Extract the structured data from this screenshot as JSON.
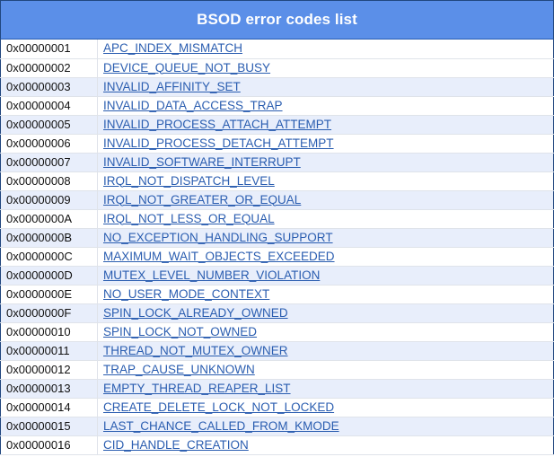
{
  "header": {
    "title": "BSOD error codes list",
    "background_color": "#5b8fe8",
    "text_color": "#ffffff"
  },
  "table": {
    "columns": [
      "code",
      "name"
    ],
    "link_color": "#2a5db0",
    "alt_row_color": "#e8eefb",
    "rows": [
      {
        "code": "0x00000001",
        "name": "APC_INDEX_MISMATCH",
        "shaded": false
      },
      {
        "code": "0x00000002",
        "name": "DEVICE_QUEUE_NOT_BUSY",
        "shaded": false
      },
      {
        "code": "0x00000003",
        "name": "INVALID_AFFINITY_SET",
        "shaded": true
      },
      {
        "code": "0x00000004",
        "name": "INVALID_DATA_ACCESS_TRAP",
        "shaded": false
      },
      {
        "code": "0x00000005",
        "name": "INVALID_PROCESS_ATTACH_ATTEMPT",
        "shaded": true
      },
      {
        "code": "0x00000006",
        "name": "INVALID_PROCESS_DETACH_ATTEMPT",
        "shaded": false
      },
      {
        "code": "0x00000007",
        "name": "INVALID_SOFTWARE_INTERRUPT",
        "shaded": true
      },
      {
        "code": "0x00000008",
        "name": "IRQL_NOT_DISPATCH_LEVEL",
        "shaded": false
      },
      {
        "code": "0x00000009",
        "name": "IRQL_NOT_GREATER_OR_EQUAL",
        "shaded": true
      },
      {
        "code": "0x0000000A",
        "name": "IRQL_NOT_LESS_OR_EQUAL",
        "shaded": false
      },
      {
        "code": "0x0000000B",
        "name": "NO_EXCEPTION_HANDLING_SUPPORT",
        "shaded": true
      },
      {
        "code": "0x0000000C",
        "name": "MAXIMUM_WAIT_OBJECTS_EXCEEDED",
        "shaded": false
      },
      {
        "code": "0x0000000D",
        "name": "MUTEX_LEVEL_NUMBER_VIOLATION",
        "shaded": true
      },
      {
        "code": "0x0000000E",
        "name": "NO_USER_MODE_CONTEXT",
        "shaded": false
      },
      {
        "code": "0x0000000F",
        "name": "SPIN_LOCK_ALREADY_OWNED",
        "shaded": true
      },
      {
        "code": "0x00000010",
        "name": "SPIN_LOCK_NOT_OWNED",
        "shaded": false
      },
      {
        "code": "0x00000011",
        "name": "THREAD_NOT_MUTEX_OWNER",
        "shaded": true
      },
      {
        "code": "0x00000012",
        "name": "TRAP_CAUSE_UNKNOWN",
        "shaded": false
      },
      {
        "code": "0x00000013",
        "name": "EMPTY_THREAD_REAPER_LIST",
        "shaded": true
      },
      {
        "code": "0x00000014",
        "name": "CREATE_DELETE_LOCK_NOT_LOCKED",
        "shaded": false
      },
      {
        "code": "0x00000015",
        "name": "LAST_CHANCE_CALLED_FROM_KMODE",
        "shaded": true
      },
      {
        "code": "0x00000016",
        "name": "CID_HANDLE_CREATION",
        "shaded": false
      }
    ]
  }
}
